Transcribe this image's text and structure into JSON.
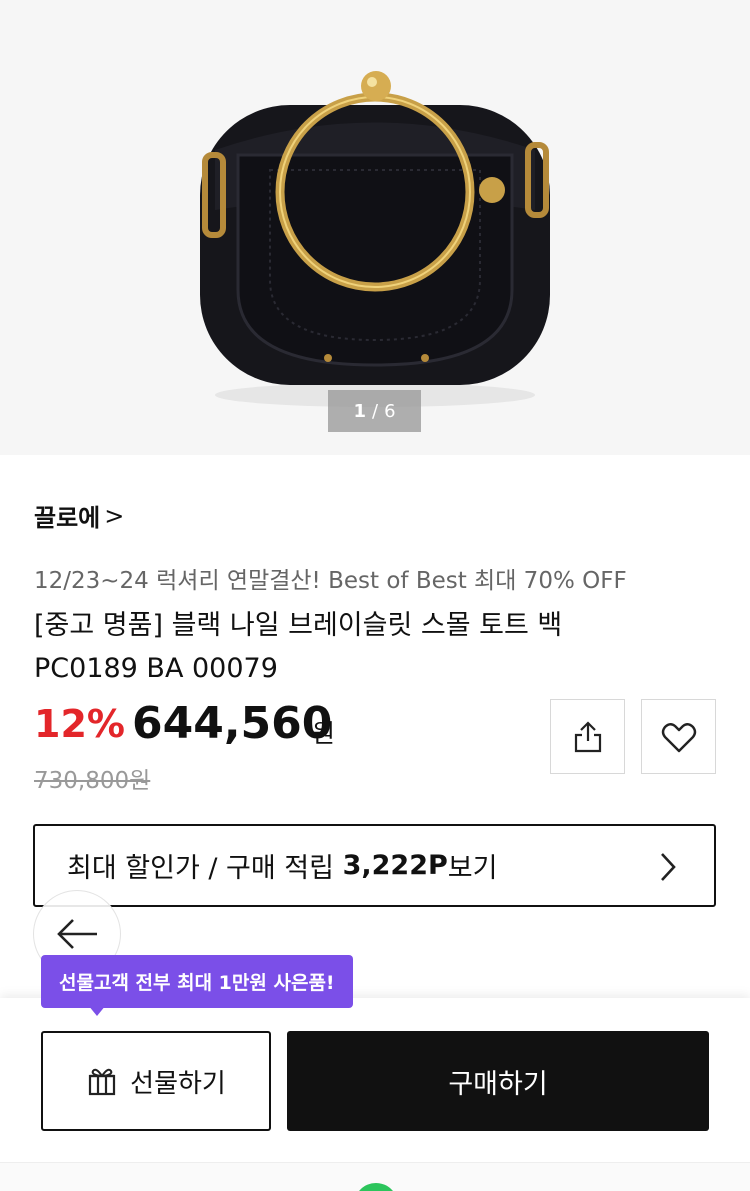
{
  "gallery": {
    "current": "1",
    "separator": "/",
    "total": "6"
  },
  "product": {
    "brand": "끌로에",
    "brand_chevron": ">",
    "promo": "12/23~24 럭셔리 연말결산! Best of Best 최대 70% OFF",
    "title": "[중고 명품] 블랙 나일 브레이슬릿 스몰 토트 백 PC0189 BA 00079",
    "discount": "12%",
    "price": "644,560",
    "currency": "원",
    "original_price": "730,800원"
  },
  "benefit": {
    "prefix": "최대 할인가 / 구매 적립 ",
    "points": "3,222P",
    "suffix": "보기"
  },
  "tooltip": {
    "text": "선물고객 전부 최대 1만원 사은품!"
  },
  "actions": {
    "gift_label": "선물하기",
    "buy_label": "구매하기"
  },
  "icons": {
    "share": "share-icon",
    "like": "heart-icon",
    "back": "arrow-left-icon",
    "gift": "gift-icon",
    "chevron": "chevron-right-icon"
  },
  "colors": {
    "discount": "#e3262a",
    "tooltip": "#7b4fe8",
    "buy_button": "#111111"
  }
}
